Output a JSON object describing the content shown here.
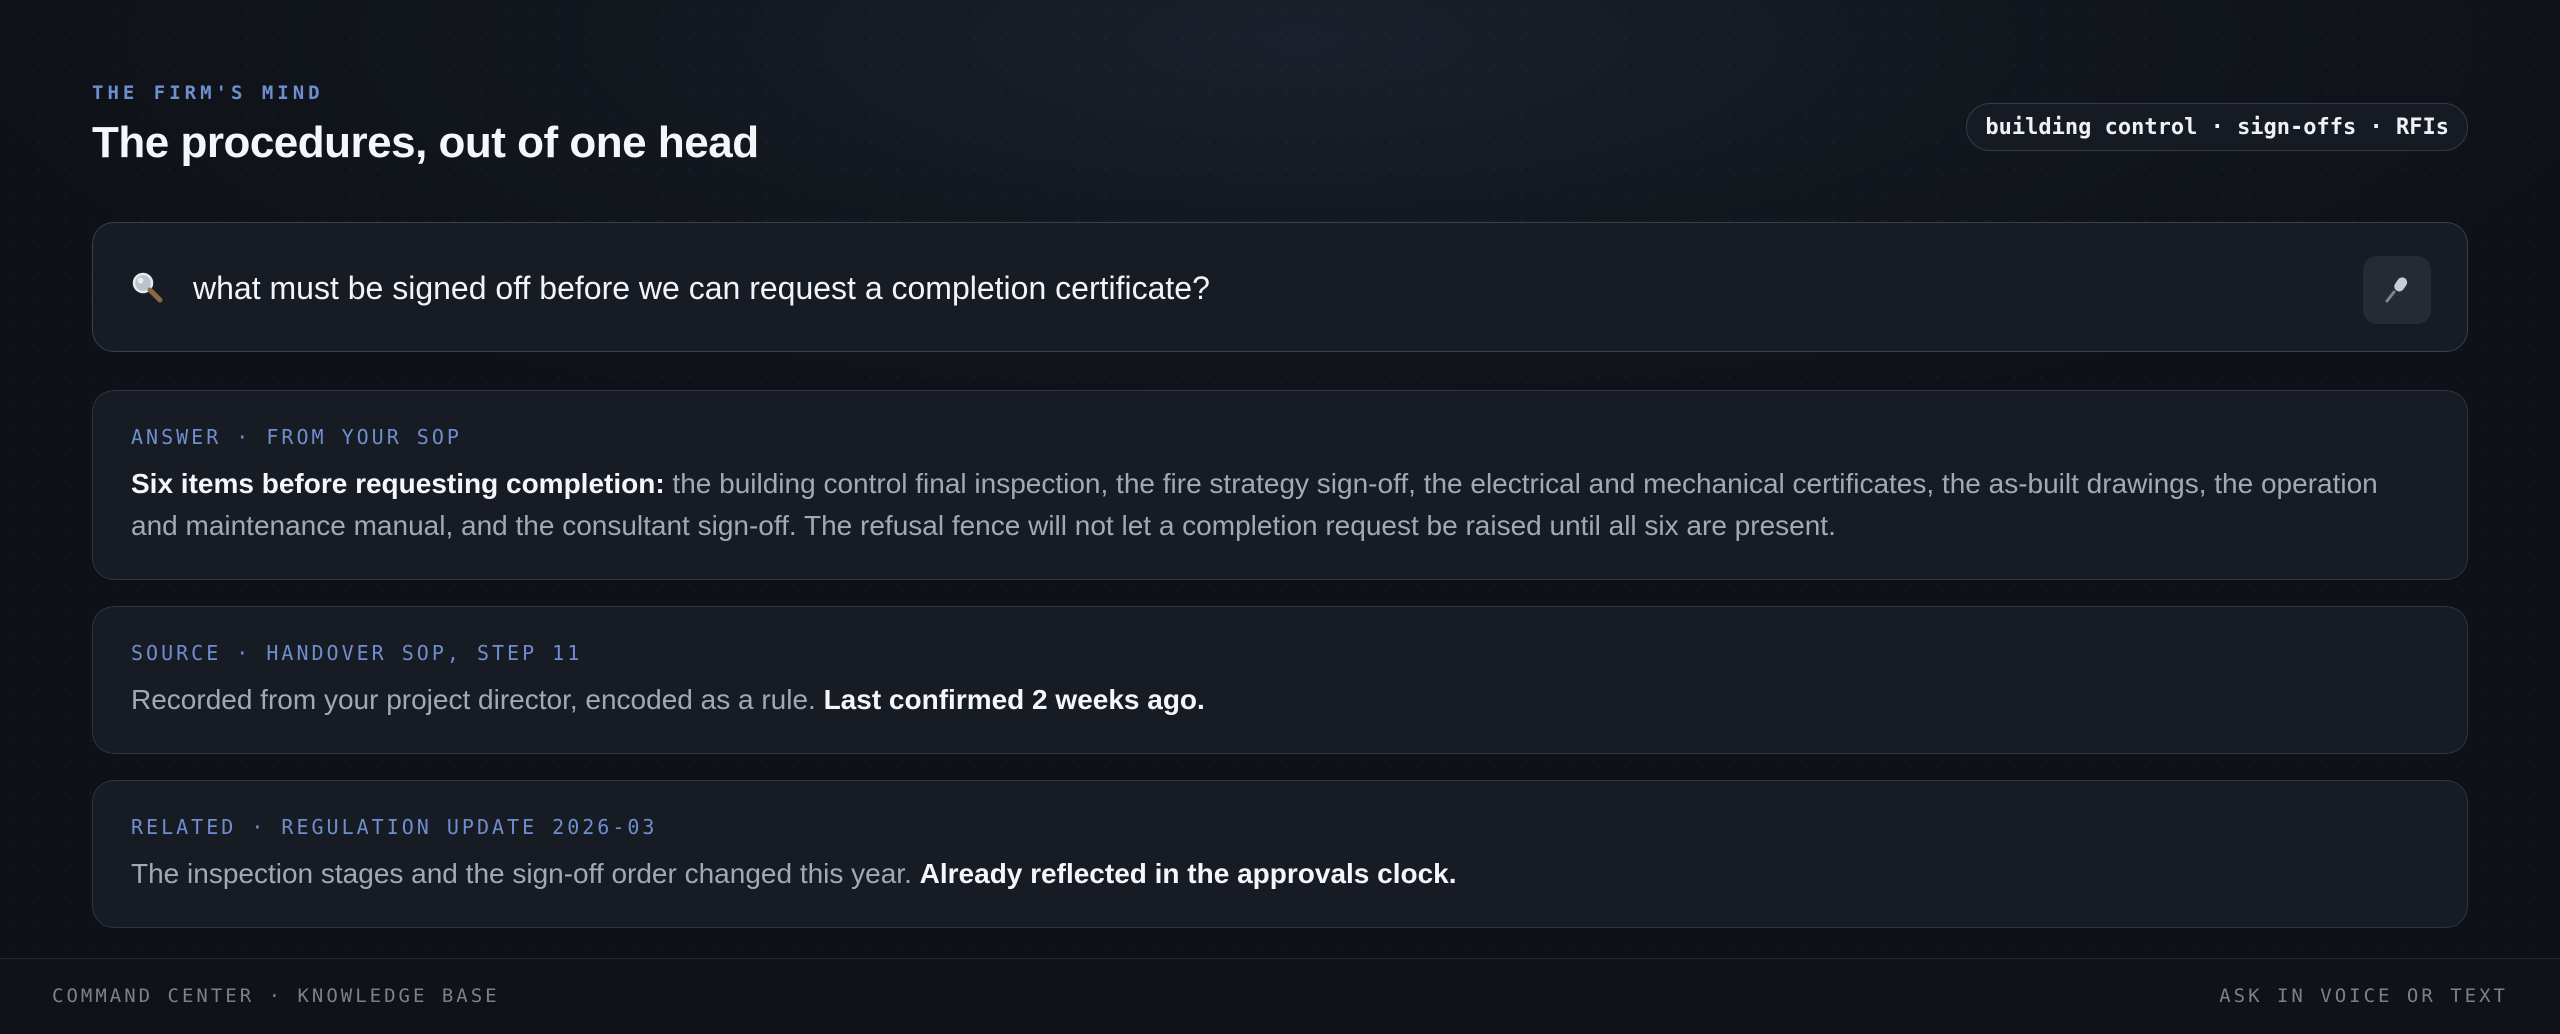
{
  "header": {
    "eyebrow": "THE FIRM'S MIND",
    "title": "The procedures, out of one head",
    "scope_pill": "building control · sign-offs · RFIs"
  },
  "search": {
    "query": "what must be signed off before we can request a completion certificate?",
    "search_icon": "search-icon",
    "mic_icon": "microphone-icon"
  },
  "answer": {
    "label": "ANSWER · FROM YOUR SOP",
    "lead": "Six items before requesting completion:",
    "body": " the building control final inspection, the fire strategy sign-off, the electrical and mechanical certificates, the as-built drawings, the operation and maintenance manual, and the consultant sign-off. The refusal fence will not let a completion request be raised until all six are present."
  },
  "source": {
    "label": "SOURCE · HANDOVER SOP, STEP 11",
    "body": "Recorded from your project director, encoded as a rule. ",
    "emphasis": "Last confirmed 2 weeks ago."
  },
  "related": {
    "label": "RELATED · REGULATION UPDATE 2026-03",
    "body": "The inspection stages and the sign-off order changed this year. ",
    "emphasis": "Already reflected in the approvals clock."
  },
  "footer": {
    "left": "COMMAND CENTER · KNOWLEDGE BASE",
    "right": "ASK IN VOICE OR TEXT"
  },
  "colors": {
    "accent": "#6f8ed0",
    "background": "#10141a",
    "card": "#171b23",
    "text_strong": "#f4f6fa",
    "text_muted": "#a3a9b4"
  }
}
